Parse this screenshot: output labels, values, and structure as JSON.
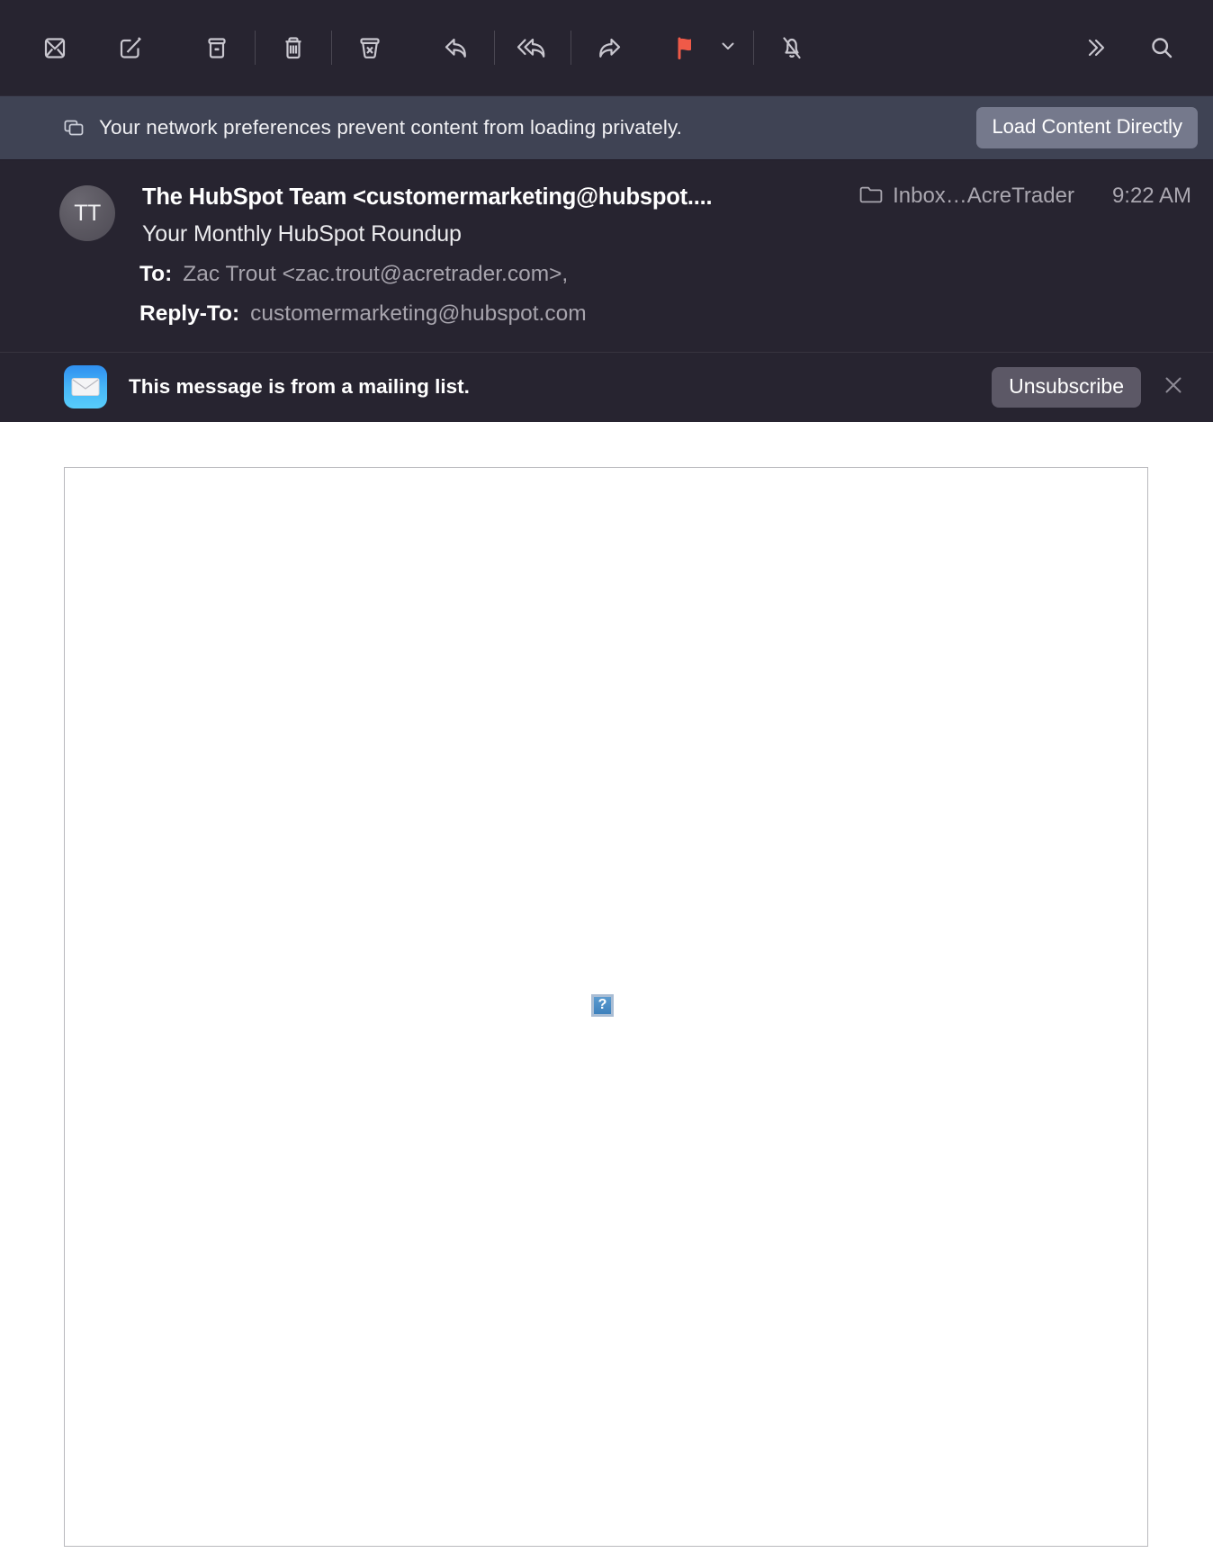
{
  "toolbar": {
    "buttons": [
      {
        "name": "mark-unread-icon",
        "label": "Mark as Unread"
      },
      {
        "name": "compose-icon",
        "label": "New Message"
      },
      {
        "name": "archive-icon",
        "label": "Archive"
      },
      {
        "name": "trash-icon",
        "label": "Delete"
      },
      {
        "name": "junk-icon",
        "label": "Move to Junk"
      },
      {
        "name": "reply-icon",
        "label": "Reply"
      },
      {
        "name": "reply-all-icon",
        "label": "Reply All"
      },
      {
        "name": "forward-icon",
        "label": "Forward"
      },
      {
        "name": "flag-icon",
        "label": "Flag"
      },
      {
        "name": "chevron-down-icon",
        "label": "Flag Options"
      },
      {
        "name": "mute-icon",
        "label": "Mute"
      },
      {
        "name": "more-icon",
        "label": "More"
      },
      {
        "name": "search-icon",
        "label": "Search"
      }
    ],
    "flag_color": "#ef5a48",
    "icon_color": "#c9c7cf",
    "background": "#272430"
  },
  "privacy_banner": {
    "icon": "copy-windows-icon",
    "message": "Your network preferences prevent content from loading privately.",
    "action_label": "Load Content Directly",
    "background": "#3f4354",
    "button_color": "#75798c"
  },
  "message_header": {
    "avatar_initials": "TT",
    "from": "The HubSpot Team <customermarketing@hubspot....",
    "mailbox_icon": "folder-icon",
    "mailbox": "Inbox…AcreTrader",
    "time": "9:22 AM",
    "subject": "Your Monthly HubSpot Roundup",
    "to_label": "To:",
    "to_value": "Zac Trout <zac.trout@acretrader.com>,",
    "reply_to_label": "Reply-To:",
    "reply_to_value": "customermarketing@hubspot.com",
    "background": "#272430"
  },
  "mailing_list_bar": {
    "app_icon": "mail-app-icon",
    "message": "This message is from a mailing list.",
    "unsubscribe_label": "Unsubscribe",
    "dismiss_icon": "close-icon",
    "background": "#272430",
    "button_color": "#5c5866"
  },
  "message_body": {
    "background": "#ffffff",
    "border_color": "#b9b9bd",
    "broken_image_glyph": "?",
    "broken_image_color": "#3e81bd"
  }
}
